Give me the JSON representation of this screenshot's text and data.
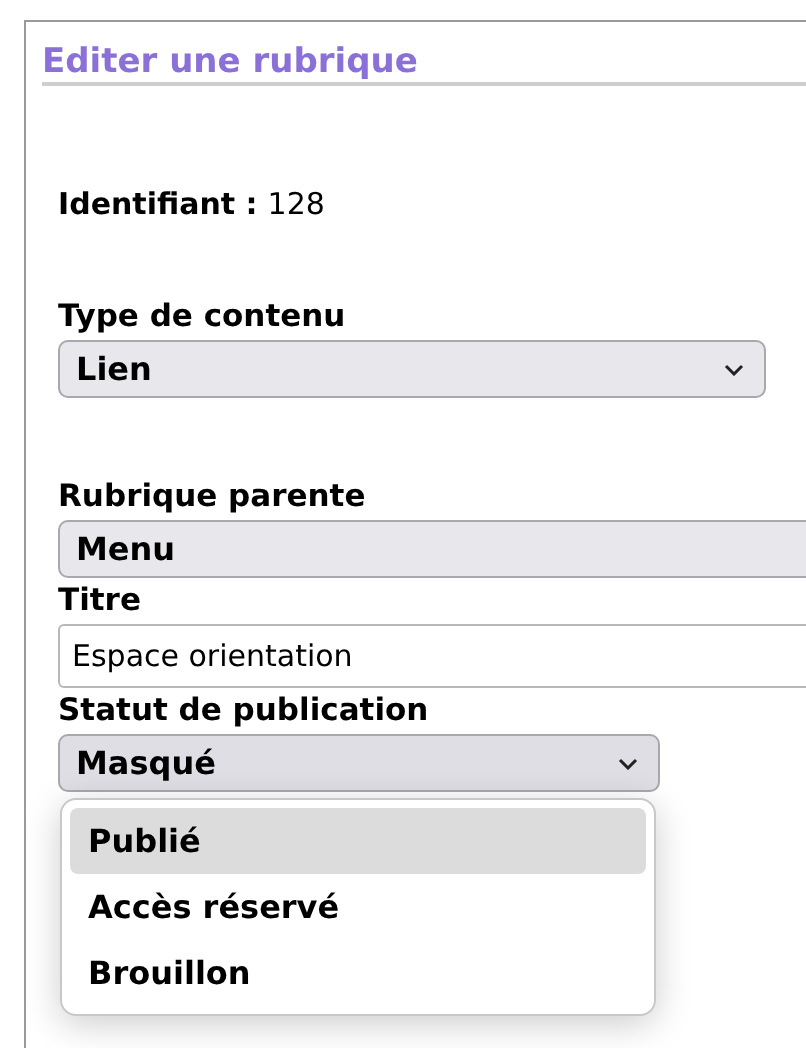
{
  "heading": "Editer une rubrique",
  "identifier": {
    "label": "Identifiant :",
    "value": "128"
  },
  "fields": [
    {
      "kind": "select",
      "label": "Type de contenu",
      "value": "Lien",
      "wide": false
    },
    {
      "kind": "select",
      "label": "Rubrique parente",
      "value": "Menu",
      "wide": true
    },
    {
      "kind": "input",
      "label": "Titre",
      "value": "Espace orientation",
      "wide": true
    },
    {
      "kind": "select",
      "label": "Statut de publication",
      "value": "Masqué",
      "wide": false,
      "open": true,
      "options": [
        {
          "label": "Publié",
          "selected": true
        },
        {
          "label": "Accès réservé",
          "selected": false
        },
        {
          "label": "Brouillon",
          "selected": false
        }
      ]
    }
  ]
}
